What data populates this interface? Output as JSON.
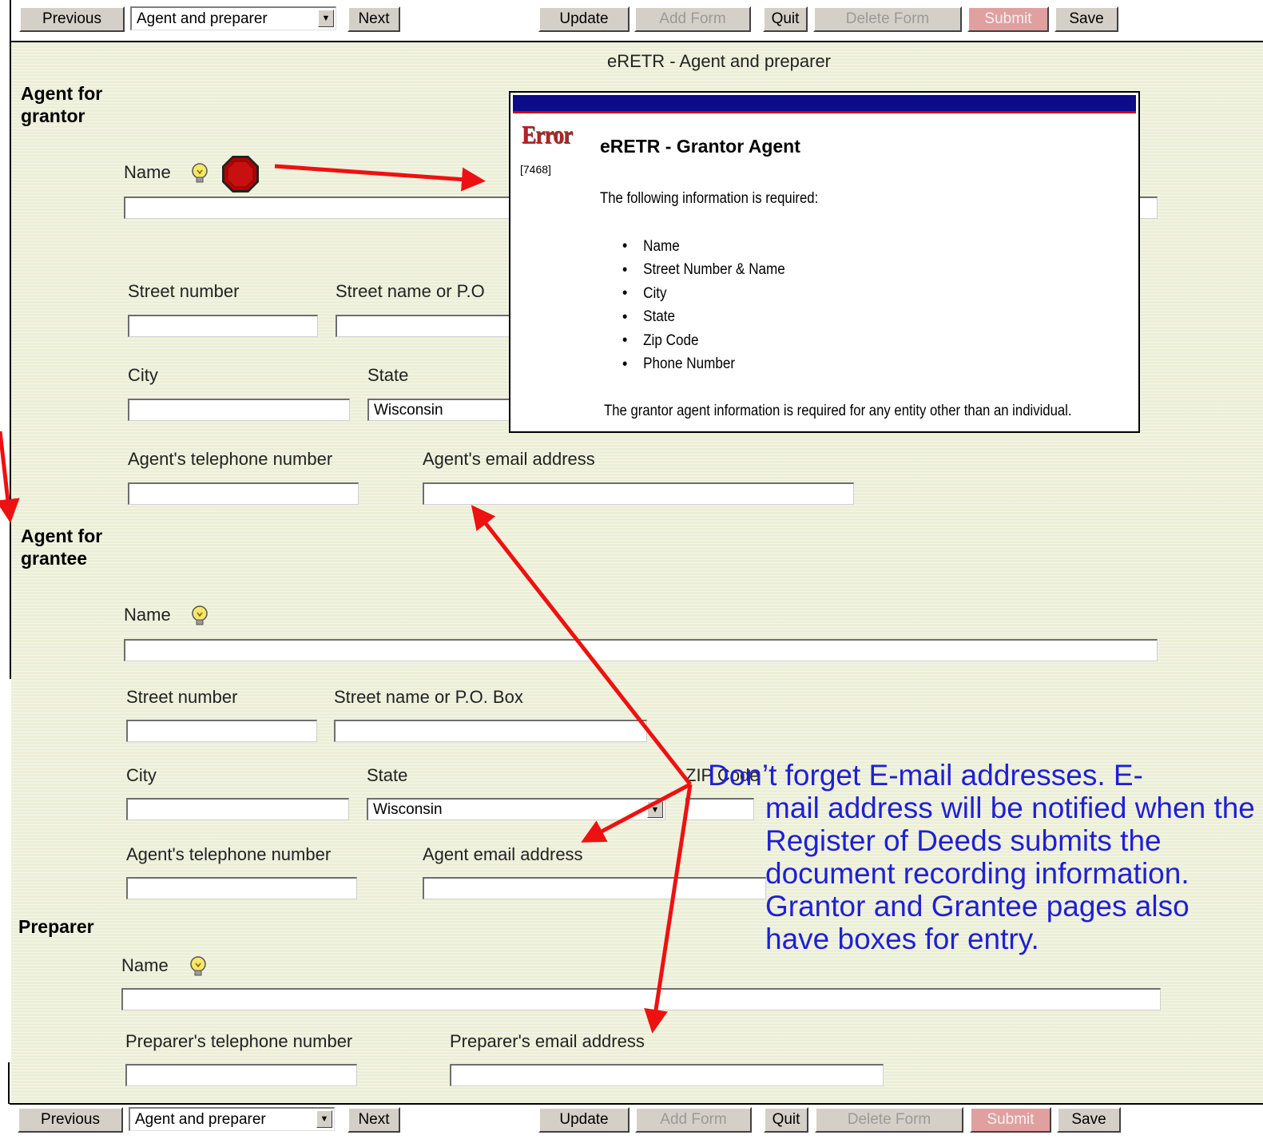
{
  "toolbar": {
    "previous": "Previous",
    "select_value": "Agent and preparer",
    "next": "Next",
    "update": "Update",
    "add_form": "Add Form",
    "quit": "Quit",
    "delete_form": "Delete Form",
    "submit": "Submit",
    "save": "Save"
  },
  "page_title": "eRETR - Agent and preparer",
  "agent_grantor": {
    "heading": "Agent for grantor",
    "name_label": "Name",
    "street_number_label": "Street number",
    "street_name_label": "Street name or P.O",
    "city_label": "City",
    "state_label": "State",
    "state_value": "Wisconsin",
    "phone_label": "Agent's telephone number",
    "email_label": "Agent's email address"
  },
  "agent_grantee": {
    "heading": "Agent for grantee",
    "name_label": "Name",
    "street_number_label": "Street number",
    "street_name_label": "Street name or P.O. Box",
    "city_label": "City",
    "state_label": "State",
    "state_value": "Wisconsin",
    "zip_label": "ZIP Code",
    "phone_label": "Agent's telephone number",
    "email_label": "Agent email address"
  },
  "preparer": {
    "heading": "Preparer",
    "name_label": "Name",
    "phone_label": "Preparer's telephone number",
    "email_label": "Preparer's email address"
  },
  "error_popup": {
    "word": "Error",
    "code": "[7468]",
    "title": "eRETR - Grantor Agent",
    "intro": "The following information is required:",
    "items": [
      "Name",
      "Street Number & Name",
      "City",
      "State",
      "Zip Code",
      "Phone Number"
    ],
    "footer": "The grantor agent information is required for any entity other than an individual."
  },
  "annotation": {
    "line1": "Don’t forget E-mail addresses.  E-",
    "rest": "mail address will be notified when the Register of Deeds submits the document recording information.  Grantor and Grantee pages also have boxes for entry."
  },
  "colors": {
    "form_bg": "#ecefd7",
    "annotation_text": "#1f1fd6",
    "arrow": "#ee1111",
    "error_bar": "#0c0c8a",
    "stop_sign": "#b30000"
  }
}
